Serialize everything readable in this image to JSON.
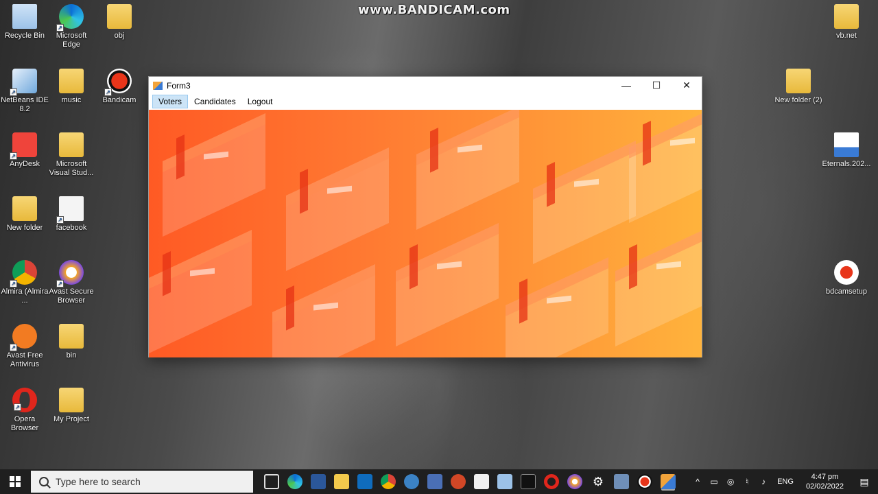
{
  "watermark": "www.BANDICAM.com",
  "desktop_icons": [
    {
      "label": "Recycle Bin",
      "icon": "recycle-bin-icon"
    },
    {
      "label": "Microsoft Edge",
      "icon": "edge-icon"
    },
    {
      "label": "obj",
      "icon": "folder-icon"
    },
    {
      "label": "NetBeans IDE 8.2",
      "icon": "netbeans-icon"
    },
    {
      "label": "music",
      "icon": "folder-icon"
    },
    {
      "label": "Bandicam",
      "icon": "bandicam-icon"
    },
    {
      "label": "AnyDesk",
      "icon": "anydesk-icon"
    },
    {
      "label": "Microsoft Visual Stud...",
      "icon": "visual-studio-folder-icon"
    },
    {
      "label": "New folder",
      "icon": "folder-icon"
    },
    {
      "label": "facebook",
      "icon": "file-icon"
    },
    {
      "label": "Almira (Almira ...",
      "icon": "chrome-profile-icon"
    },
    {
      "label": "Avast Secure Browser",
      "icon": "avast-browser-icon"
    },
    {
      "label": "Avast Free Antivirus",
      "icon": "avast-icon"
    },
    {
      "label": "bin",
      "icon": "folder-icon"
    },
    {
      "label": "Opera Browser",
      "icon": "opera-icon"
    },
    {
      "label": "My Project",
      "icon": "folder-icon"
    },
    {
      "label": "vb.net",
      "icon": "folder-icon"
    },
    {
      "label": "New folder (2)",
      "icon": "folder-icon"
    },
    {
      "label": "Eternals.202...",
      "icon": "video-file-icon"
    },
    {
      "label": "bdcamsetup",
      "icon": "installer-icon"
    }
  ],
  "window": {
    "title": "Form3",
    "menu": [
      "Voters",
      "Candidates",
      "Logout"
    ],
    "active_menu": "Voters",
    "controls": {
      "minimize": "—",
      "maximize": "☐",
      "close": "✕"
    }
  },
  "taskbar": {
    "search_placeholder": "Type here to search",
    "language": "ENG",
    "time": "4:47 pm",
    "date": "02/02/2022",
    "pinned": [
      "task-view-icon",
      "edge-icon",
      "word-icon",
      "file-explorer-icon",
      "mail-icon",
      "chrome-icon",
      "network-app-icon",
      "link-app-icon",
      "powerpoint-icon",
      "java-icon",
      "cube-app-icon",
      "terminal-icon",
      "opera-icon",
      "avast-browser-icon",
      "settings-icon",
      "network-tool-icon",
      "record-icon",
      "app-form-icon"
    ]
  },
  "colors": {
    "accent_orange": "#ff7a32",
    "menu_active": "#cce4f7",
    "taskbar": "#1f1f1f"
  }
}
